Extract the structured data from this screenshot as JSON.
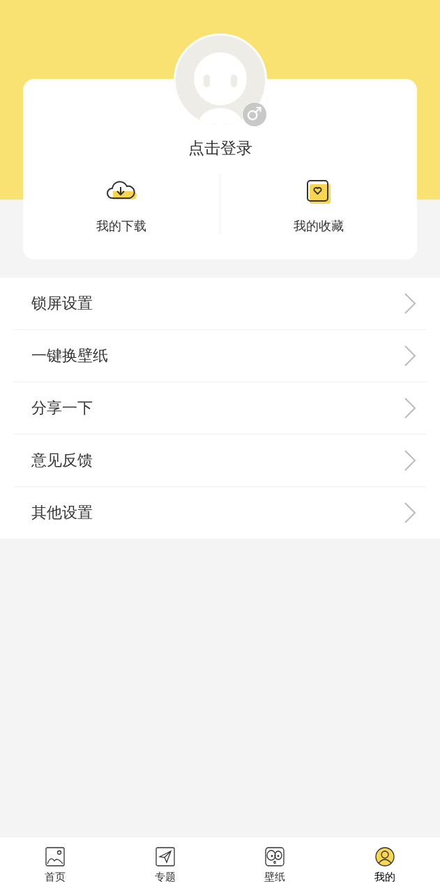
{
  "profile": {
    "login_text": "点击登录",
    "gender_symbol": "♂"
  },
  "shortcuts": [
    {
      "kind": "download",
      "label": "我的下载"
    },
    {
      "kind": "favorite",
      "label": "我的收藏"
    }
  ],
  "menu": [
    {
      "label": "锁屏设置"
    },
    {
      "label": "一键换壁纸"
    },
    {
      "label": "分享一下"
    },
    {
      "label": "意见反馈"
    },
    {
      "label": "其他设置"
    }
  ],
  "tabs": [
    {
      "kind": "image",
      "label": "首页",
      "selected": false
    },
    {
      "kind": "plane",
      "label": "专题",
      "selected": false
    },
    {
      "kind": "face",
      "label": "壁纸",
      "selected": false
    },
    {
      "kind": "person",
      "label": "我的",
      "selected": true
    }
  ]
}
